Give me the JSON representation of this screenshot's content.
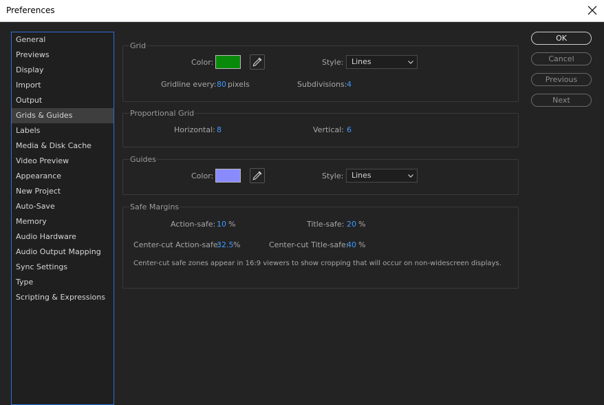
{
  "window": {
    "title": "Preferences"
  },
  "sidebar": {
    "items": [
      {
        "label": "General"
      },
      {
        "label": "Previews"
      },
      {
        "label": "Display"
      },
      {
        "label": "Import"
      },
      {
        "label": "Output"
      },
      {
        "label": "Grids & Guides"
      },
      {
        "label": "Labels"
      },
      {
        "label": "Media & Disk Cache"
      },
      {
        "label": "Video Preview"
      },
      {
        "label": "Appearance"
      },
      {
        "label": "New Project"
      },
      {
        "label": "Auto-Save"
      },
      {
        "label": "Memory"
      },
      {
        "label": "Audio Hardware"
      },
      {
        "label": "Audio Output Mapping"
      },
      {
        "label": "Sync Settings"
      },
      {
        "label": "Type"
      },
      {
        "label": "Scripting & Expressions"
      }
    ],
    "selected": "Grids & Guides"
  },
  "grid": {
    "title": "Grid",
    "color_label": "Color:",
    "color": "#0a8a0a",
    "style_label": "Style:",
    "style_value": "Lines",
    "gridline_label": "Gridline every:",
    "gridline_value": "80",
    "gridline_unit": "pixels",
    "subdivisions_label": "Subdivisions:",
    "subdivisions_value": "4"
  },
  "proportional_grid": {
    "title": "Proportional Grid",
    "horizontal_label": "Horizontal:",
    "horizontal_value": "8",
    "vertical_label": "Vertical:",
    "vertical_value": "6"
  },
  "guides": {
    "title": "Guides",
    "color_label": "Color:",
    "color": "#8a8aff",
    "style_label": "Style:",
    "style_value": "Lines"
  },
  "safe_margins": {
    "title": "Safe Margins",
    "action_label": "Action-safe:",
    "action_value": "10",
    "title_label": "Title-safe:",
    "title_value": "20",
    "cc_action_label": "Center-cut Action-safe:",
    "cc_action_value": "32.5",
    "cc_title_label": "Center-cut Title-safe:",
    "cc_title_value": "40",
    "percent": "%",
    "note": "Center-cut safe zones appear in 16:9 viewers to show cropping that will occur on non-widescreen displays."
  },
  "buttons": {
    "ok": "OK",
    "cancel": "Cancel",
    "previous": "Previous",
    "next": "Next"
  }
}
